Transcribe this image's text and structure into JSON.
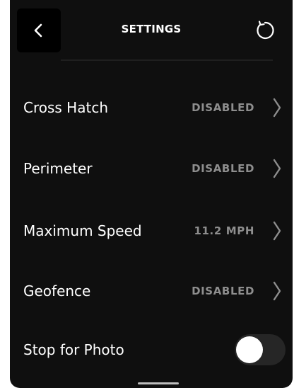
{
  "header": {
    "title": "SETTINGS",
    "back_icon": "chevron-left-icon",
    "reset_icon": "refresh-icon"
  },
  "settings": [
    {
      "label": "Cross Hatch",
      "value": "DISABLED",
      "icon": "chevron-right-icon"
    },
    {
      "label": "Perimeter",
      "value": "DISABLED",
      "icon": "chevron-right-icon"
    },
    {
      "label": "Maximum Speed",
      "value": "11.2 MPH",
      "icon": "chevron-right-icon"
    },
    {
      "label": "Geofence",
      "value": "DISABLED",
      "icon": "chevron-right-icon"
    }
  ],
  "stop_for_photo": {
    "label": "Stop for Photo",
    "enabled": false
  },
  "colors": {
    "background": "#0f0f0f",
    "text": "#ffffff",
    "value_text": "#8e8e8e",
    "toggle_track": "#262626",
    "toggle_knob": "#ffffff"
  }
}
